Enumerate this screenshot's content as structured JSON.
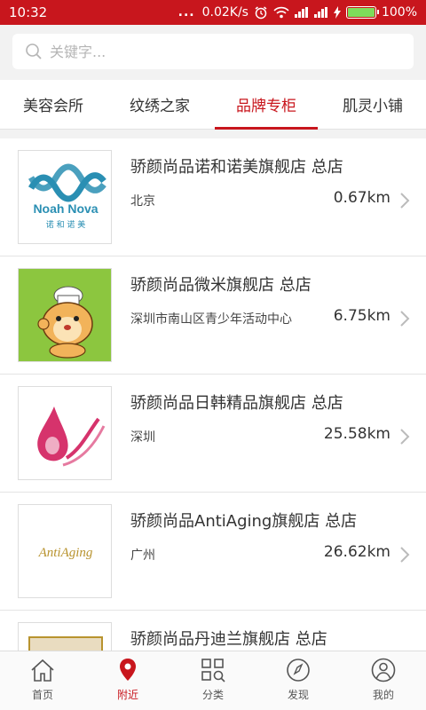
{
  "status_bar": {
    "time": "10:32",
    "dots": "...",
    "speed": "0.02K/s",
    "battery": "100%",
    "battery_level": 1.0
  },
  "search": {
    "placeholder": "关键字..."
  },
  "tabs": [
    {
      "label": "美容会所",
      "active": false
    },
    {
      "label": "纹绣之家",
      "active": false
    },
    {
      "label": "品牌专柜",
      "active": true
    },
    {
      "label": "肌灵小铺",
      "active": false
    }
  ],
  "stores": [
    {
      "title": "骄颜尚品诺和诺美旗舰店 总店",
      "address": "北京",
      "distance": "0.67km",
      "logo_text": "Noah Nova",
      "logo_sub": "诺 和 诺 美"
    },
    {
      "title": "骄颜尚品微米旗舰店 总店",
      "address": "深圳市南山区青少年活动中心",
      "distance": "6.75km"
    },
    {
      "title": "骄颜尚品日韩精品旗舰店 总店",
      "address": "深圳",
      "distance": "25.58km"
    },
    {
      "title": "骄颜尚品AntiAging旗舰店 总店",
      "address": "广州",
      "distance": "26.62km",
      "logo_text": "AntiAging"
    },
    {
      "title": "骄颜尚品丹迪兰旗舰店 总店",
      "address": "",
      "distance": ""
    }
  ],
  "bottom_nav": [
    {
      "label": "首页",
      "icon": "home-icon",
      "active": false
    },
    {
      "label": "附近",
      "icon": "location-pin-icon",
      "active": true
    },
    {
      "label": "分类",
      "icon": "grid-search-icon",
      "active": false
    },
    {
      "label": "发现",
      "icon": "compass-icon",
      "active": false
    },
    {
      "label": "我的",
      "icon": "user-icon",
      "active": false
    }
  ],
  "colors": {
    "accent": "#c8161d",
    "background": "#f2f2f2"
  }
}
